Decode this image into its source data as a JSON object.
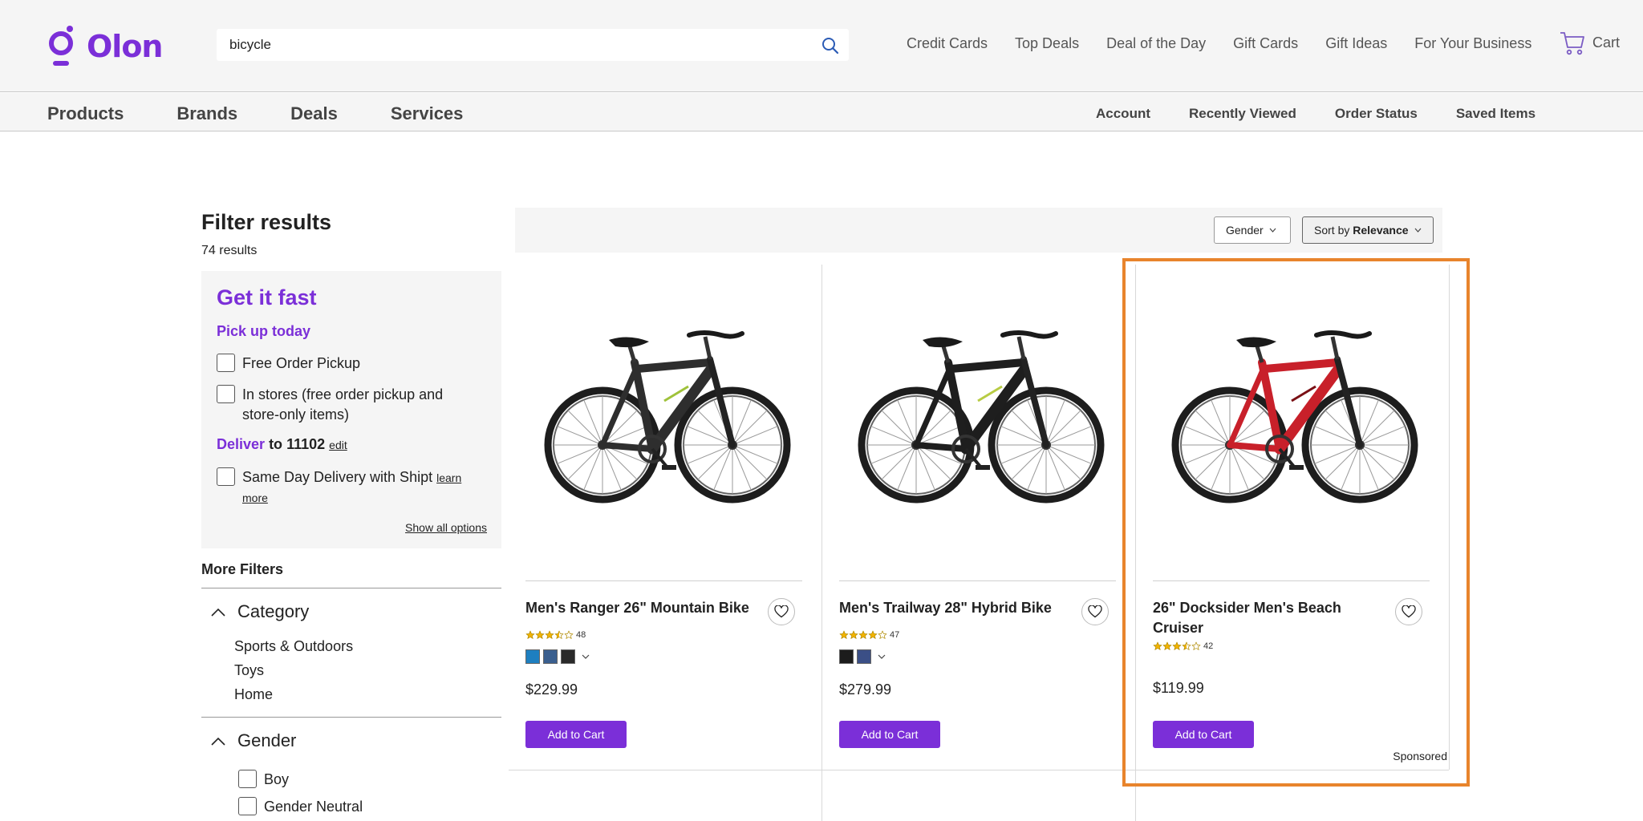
{
  "brand": {
    "name": "Olon",
    "color": "#7b2fd8"
  },
  "search": {
    "value": "bicycle",
    "placeholder": ""
  },
  "top_links": [
    "Credit Cards",
    "Top Deals",
    "Deal of the Day",
    "Gift Cards",
    "Gift Ideas",
    "For Your Business"
  ],
  "cart": {
    "label": "Cart"
  },
  "main_nav": [
    "Products",
    "Brands",
    "Deals",
    "Services"
  ],
  "account_nav": [
    "Account",
    "Recently Viewed",
    "Order Status",
    "Saved Items"
  ],
  "filters": {
    "title": "Filter results",
    "result_count": "74 results",
    "fast": {
      "title": "Get it fast",
      "pickup_title": "Pick up today",
      "free_pickup": "Free Order Pickup",
      "in_stores_line1": "In stores (free order pickup and",
      "in_stores_line2": "store-only items)",
      "deliver_word": "Deliver",
      "deliver_to": "to",
      "zip": "11102",
      "edit": "edit",
      "same_day": "Same Day Delivery with Shipt",
      "learn": "learn",
      "more": "more",
      "show_all": "Show all options"
    },
    "more_filters": "More Filters",
    "category": {
      "label": "Category",
      "items": [
        "Sports & Outdoors",
        "Toys",
        "Home"
      ]
    },
    "gender": {
      "label": "Gender",
      "items": [
        "Boy",
        "Gender Neutral"
      ]
    }
  },
  "results_bar": {
    "gender_label": "Gender",
    "sort_prefix": "Sort by",
    "sort_value": "Relevance"
  },
  "products": [
    {
      "title": "Men's Ranger 26\" Mountain Bike",
      "rating": 3.5,
      "reviews": "48",
      "swatches": [
        "#1e7fc0",
        "#3a5f8f",
        "#2a2a2a"
      ],
      "price": "$229.99",
      "add_label": "Add to Cart",
      "frame_color": "#2e2e2e",
      "accent": "#9fc23a"
    },
    {
      "title": "Men's Trailway 28\" Hybrid Bike",
      "rating": 4,
      "reviews": "47",
      "swatches": [
        "#1c1c1c",
        "#3b4f86"
      ],
      "price": "$279.99",
      "add_label": "Add to Cart",
      "frame_color": "#1e1e1e",
      "accent": "#b8cc44"
    },
    {
      "title": "26\" Docksider Men's Beach Cruiser",
      "rating": 3.5,
      "reviews": "42",
      "swatches": [],
      "price": "$119.99",
      "add_label": "Add to Cart",
      "sponsored": "Sponsored",
      "frame_color": "#c8202a",
      "accent": "#7a1015"
    }
  ],
  "highlight_color": "#e8842c"
}
